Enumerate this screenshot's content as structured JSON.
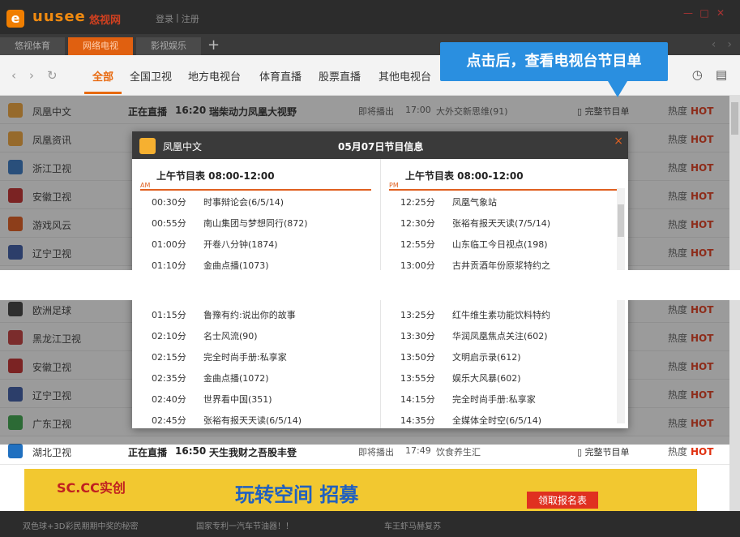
{
  "app": {
    "logo_e": "e",
    "logo_text": "uusee",
    "logo_cn": "悠视网",
    "login": "登录",
    "sep": "|",
    "register": "注册"
  },
  "tabs": [
    {
      "label": "悠视体育"
    },
    {
      "label": "网络电视",
      "active": true
    },
    {
      "label": "影视娱乐"
    }
  ],
  "tab_add": "+",
  "categories": [
    "全部",
    "全国卫视",
    "地方电视台",
    "体育直播",
    "股票直播",
    "其他电视台"
  ],
  "tooltip": "点击后，查看电视台节目单",
  "rows_top": [
    {
      "name": "凤凰中文",
      "status": "正在直播",
      "time": "16:20",
      "prog": "瑞柴动力凤凰大视野",
      "next_label": "即将播出",
      "next_time": "17:00",
      "next_prog": "大外交新思维(91)",
      "full": "完整节目单",
      "hot_label": "热度",
      "hot": "HOT",
      "icon_color": "#f0a030"
    },
    {
      "name": "凤凰资讯",
      "status": "",
      "time": "",
      "prog": "",
      "next_label": "",
      "next_time": "",
      "next_prog": "",
      "full": "",
      "hot_label": "热度",
      "hot": "HOT",
      "icon_color": "#f0a030"
    },
    {
      "name": "浙江卫视",
      "status": "",
      "time": "",
      "prog": "",
      "next_label": "",
      "next_time": "",
      "next_prog": "",
      "full": "",
      "hot_label": "热度",
      "hot": "HOT",
      "icon_color": "#2a70c0"
    },
    {
      "name": "安徽卫视",
      "status": "",
      "time": "",
      "prog": "",
      "next_label": "",
      "next_time": "",
      "next_prog": "",
      "full": "",
      "hot_label": "热度",
      "hot": "HOT",
      "icon_color": "#c02020"
    },
    {
      "name": "游戏风云",
      "status": "",
      "time": "",
      "prog": "",
      "next_label": "",
      "next_time": "",
      "next_prog": "",
      "full": "",
      "hot_label": "热度",
      "hot": "HOT",
      "icon_color": "#e05010"
    },
    {
      "name": "辽宁卫视",
      "status": "",
      "time": "",
      "prog": "",
      "next_label": "",
      "next_time": "",
      "next_prog": "",
      "full": "",
      "hot_label": "热度",
      "hot": "HOT",
      "icon_color": "#3050a0"
    }
  ],
  "rows_bottom": [
    {
      "name": "欧洲足球",
      "hot_label": "热度",
      "hot": "HOT",
      "icon_color": "#333"
    },
    {
      "name": "黑龙江卫视",
      "hot_label": "热度",
      "hot": "HOT",
      "icon_color": "#c03030"
    },
    {
      "name": "安徽卫视",
      "hot_label": "热度",
      "hot": "HOT",
      "icon_color": "#c02020"
    },
    {
      "name": "辽宁卫视",
      "hot_label": "热度",
      "hot": "HOT",
      "icon_color": "#3050a0"
    },
    {
      "name": "广东卫视",
      "hot_label": "热度",
      "hot": "HOT",
      "icon_color": "#30a040"
    }
  ],
  "row_hubei": {
    "name": "湖北卫视",
    "status": "正在直播",
    "time": "16:50",
    "prog": "天生我财之吾股丰登",
    "next_label": "即将播出",
    "next_time": "17:49",
    "next_prog": "饮食养生汇",
    "full": "完整节目单",
    "hot_label": "热度",
    "hot": "HOT",
    "icon_color": "#2070c0"
  },
  "popup": {
    "channel": "凤凰中文",
    "title": "05月07日节目信息",
    "close": "×",
    "left_header": "上午节目表 08:00-12:00",
    "left_tag": "AM",
    "right_header": "上午节目表 08:00-12:00",
    "right_tag": "PM",
    "left_top": [
      [
        "00:30分",
        "时事辩论会(6/5/14)"
      ],
      [
        "00:55分",
        "南山集团与梦想同行(872)"
      ],
      [
        "01:00分",
        "开卷八分钟(1874)"
      ],
      [
        "01:10分",
        "金曲点播(1073)"
      ]
    ],
    "right_top": [
      [
        "12:25分",
        "凤凰气象站"
      ],
      [
        "12:30分",
        "张裕有报天天读(7/5/14)"
      ],
      [
        "12:55分",
        "山东临工今日视点(198)"
      ],
      [
        "13:00分",
        "古井贡酒年份原浆特约之"
      ]
    ],
    "left_bottom": [
      [
        "01:15分",
        "鲁豫有约:说出你的故事"
      ],
      [
        "02:10分",
        "名士风流(90)"
      ],
      [
        "02:15分",
        "完全时尚手册:私享家"
      ],
      [
        "02:35分",
        "金曲点播(1072)"
      ],
      [
        "02:40分",
        "世界看中国(351)"
      ],
      [
        "02:45分",
        "张裕有报天天读(6/5/14)"
      ]
    ],
    "right_bottom": [
      [
        "13:25分",
        "红牛维生素功能饮料特约"
      ],
      [
        "13:30分",
        "华润凤凰焦点关注(602)"
      ],
      [
        "13:50分",
        "文明启示录(612)"
      ],
      [
        "13:55分",
        "娱乐大风暴(602)"
      ],
      [
        "14:15分",
        "完全时尚手册:私享家"
      ],
      [
        "14:35分",
        "全媒体全时空(6/5/14)"
      ]
    ]
  },
  "banner": {
    "b1": "SC.CC实创",
    "b2": "玩转空间 招募",
    "b3": "领取报名表"
  },
  "footer": [
    "双色球+3D彩民期期中奖的秘密",
    "国家专利一汽车节油器！！",
    "车王虾马赫复苏"
  ]
}
